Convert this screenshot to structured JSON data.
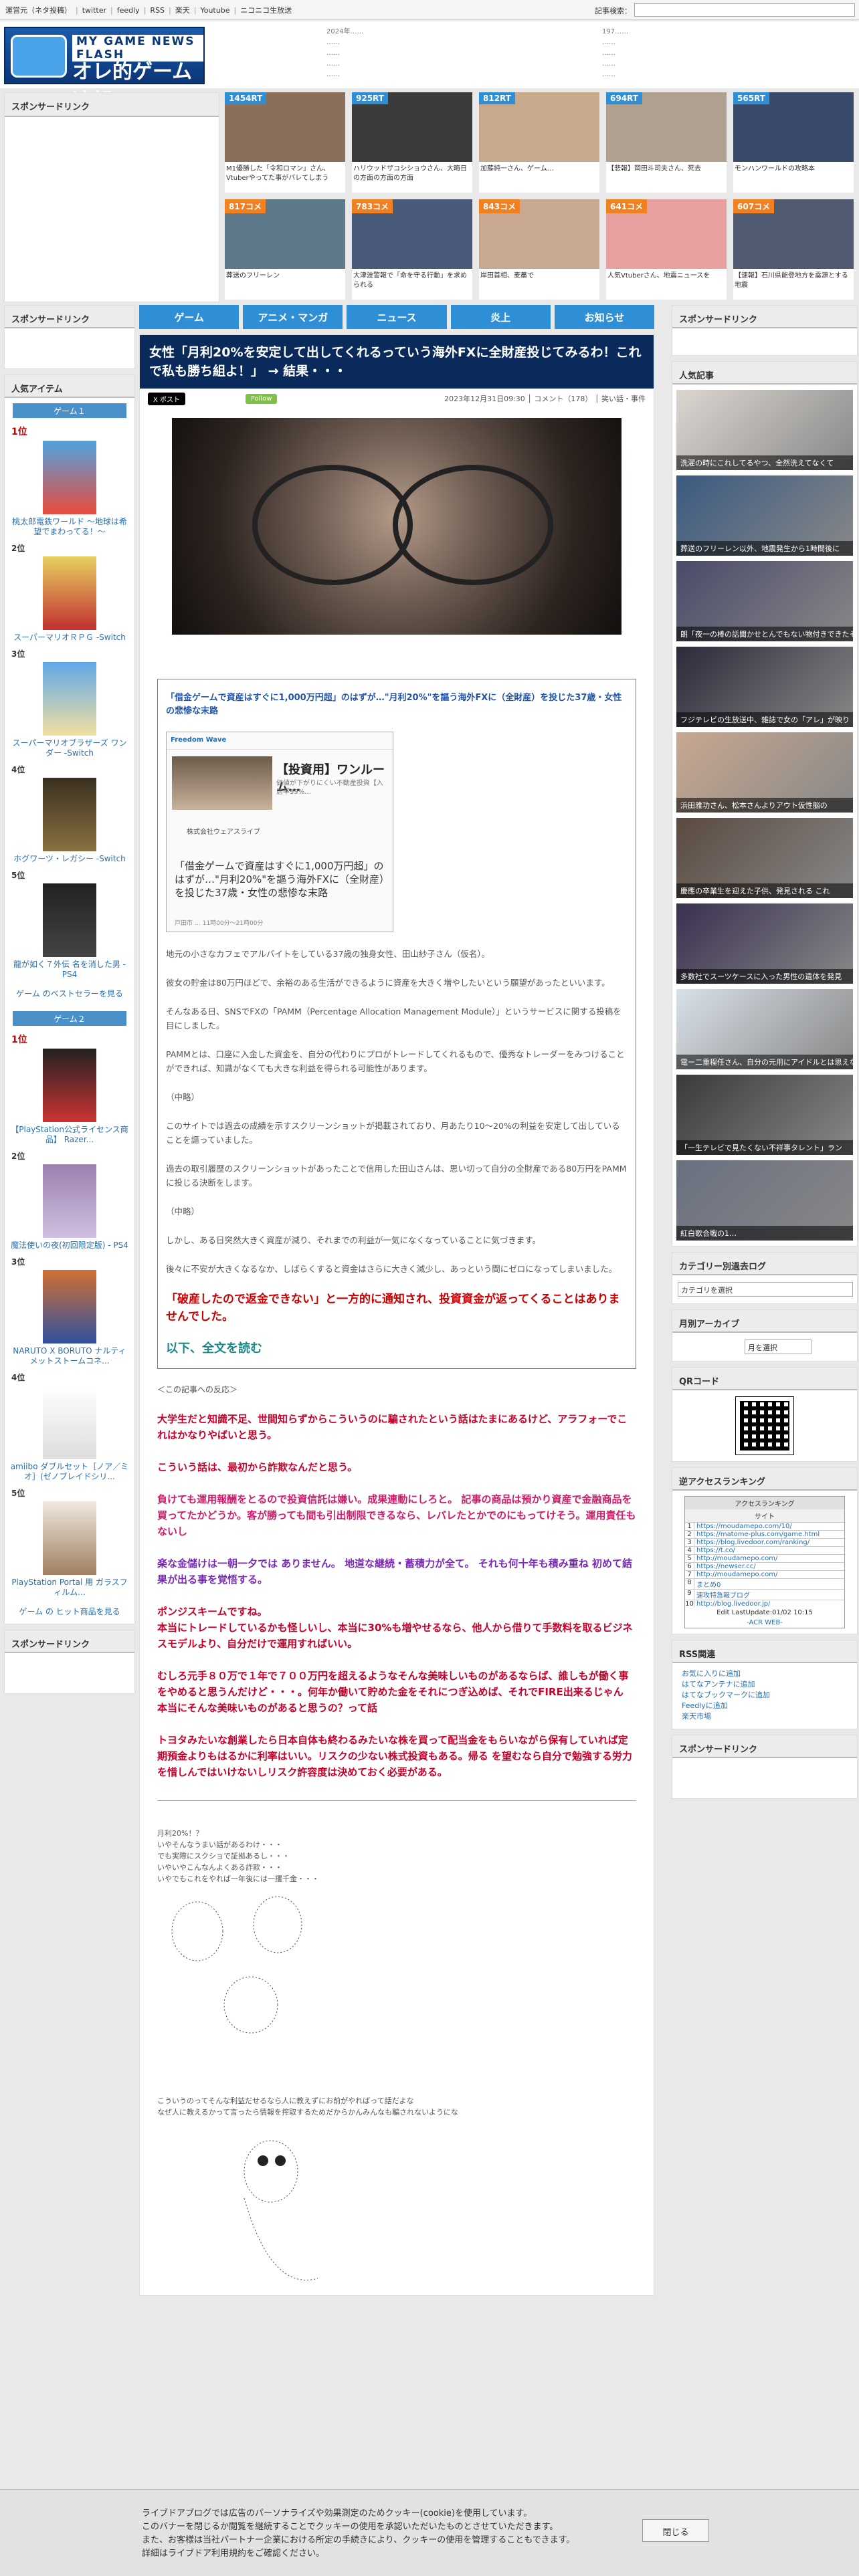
{
  "topbar": {
    "links": [
      "運営元（ネタ投稿）",
      "twitter",
      "feedly",
      "RSS",
      "楽天",
      "Youtube",
      "ニコニコ生放送"
    ],
    "search_label": "記事検索："
  },
  "header": {
    "logo_small": "MY GAME NEWS FLASH",
    "logo_big": "オレ的ゲーム速報@JIN",
    "news_left": [
      "2024年……",
      "……",
      "……",
      "……",
      "……"
    ],
    "news_right": [
      "197……",
      "……",
      "……",
      "……",
      "……"
    ]
  },
  "sponsor_left_title": "スポンサードリンク",
  "rt_cards": [
    {
      "badge": "1454RT",
      "text": "M1優勝した「令和ロマン」さん、Vtuberやってた事がバレてしまう",
      "type": "rt"
    },
    {
      "badge": "925RT",
      "text": "ハリウッドザコシショウさん、大晦日の方面の方面の方面",
      "type": "rt"
    },
    {
      "badge": "812RT",
      "text": "加藤純一さん、ゲーム…",
      "type": "rt"
    },
    {
      "badge": "694RT",
      "text": "【悲報】岡田斗司夫さん、死去",
      "type": "rt"
    },
    {
      "badge": "565RT",
      "text": "モンハンワールドの攻略本",
      "type": "rt"
    },
    {
      "badge": "817コメ",
      "text": "葬送のフリーレン",
      "type": "com"
    },
    {
      "badge": "783コメ",
      "text": "大津波警報で「命を守る行動」を求められる",
      "type": "com"
    },
    {
      "badge": "843コメ",
      "text": "岸田首相、麦藁で",
      "type": "com"
    },
    {
      "badge": "641コメ",
      "text": "人気Vtuberさん、地震ニュースを",
      "type": "com"
    },
    {
      "badge": "607コメ",
      "text": "【速報】石川県能登地方を震源とする地震",
      "type": "com"
    }
  ],
  "left_col": {
    "title": "スポンサードリンク",
    "popular_title": "人気アイテム",
    "group1": "ゲーム１",
    "items1": [
      {
        "rank": "1位",
        "name": "桃太郎電鉄ワールド ～地球は希望でまわってる！～"
      },
      {
        "rank": "2位",
        "name": "スーパーマリオＲＰＧ -Switch"
      },
      {
        "rank": "3位",
        "name": "スーパーマリオブラザーズ ワンダー -Switch"
      },
      {
        "rank": "4位",
        "name": "ホグワーツ・レガシー -Switch"
      },
      {
        "rank": "5位",
        "name": "龍が如く７外伝 名を消した男 - PS4"
      }
    ],
    "more1": "ゲーム のベストセラーを見る",
    "group2": "ゲーム２",
    "items2": [
      {
        "rank": "1位",
        "name": "【PlayStation公式ライセンス商品】 Razer..."
      },
      {
        "rank": "2位",
        "name": "魔法使いの夜(初回限定版) - PS4"
      },
      {
        "rank": "3位",
        "name": "NARUTO X BORUTO ナルティメットストームコネ..."
      },
      {
        "rank": "4位",
        "name": "amiibo ダブルセット［ノア／ミオ］(ゼノブレイドシリ..."
      },
      {
        "rank": "5位",
        "name": "PlayStation Portal 用 ガラスフィルム..."
      }
    ],
    "more2": "ゲーム の ヒット商品を見る",
    "sponsor2": "スポンサードリンク"
  },
  "nav": [
    "ゲーム",
    "アニメ・マンガ",
    "ニュース",
    "炎上",
    "お知らせ"
  ],
  "article": {
    "title": "女性「月利20%を安定して出してくれるっていう海外FXに全財産投じてみるわ！これで私も勝ち組よ！」 → 結果・・・",
    "x_button": "X ポスト",
    "follow_button": "Follow",
    "meta": "2023年12月31日09:30 │ コメント（178） │ 笑い話・事件",
    "quote_title": "「借金ゲームで資産はすぐに1,000万円超」のはずが…\"月利20%\"を謳う海外FXに（全財産）を投じた37歳・女性の悲惨な末路",
    "embed": {
      "header": "Freedom Wave",
      "headline": "【投資用】ワンルーム…",
      "sub": "価値が下がりにくい不動産投資【入居率99%…",
      "company": "株式会社ウェアスライブ",
      "big": "「借金ゲームで資産はすぐに1,000万円超」のはずが…\"月利20%\"を謳う海外FXに（全財産）を投じた37歳・女性の悲惨な末路",
      "foot": "戸田市 … 11時00分～21時00分"
    },
    "paras": [
      "地元の小さなカフェでアルバイトをしている37歳の独身女性、田山紗子さん（仮名）。",
      "彼女の貯金は80万円ほどで、余裕のある生活ができるように資産を大きく増やしたいという願望があったといいます。",
      "そんなある日、SNSでFXの「PAMM（Percentage Allocation Management Module）」というサービスに関する投稿を目にしました。",
      "PAMMとは、口座に入金した資金を、自分の代わりにプロがトレードしてくれるもので、優秀なトレーダーをみつけることができれば、知識がなくても大きな利益を得られる可能性があります。",
      "（中略）",
      "このサイトでは過去の成績を示すスクリーンショットが掲載されており、月あたり10～20%の利益を安定して出していることを謳っていました。",
      "過去の取引履歴のスクリーンショットがあったことで信用した田山さんは、思い切って自分の全財産である80万円をPAMMに投じる決断をします。",
      "（中略）",
      "しかし、ある日突然大きく資産が減り、それまでの利益が一気になくなっていることに気づきます。",
      "後々に不安が大きくなるなか、しばらくすると資金はさらに大きく減少し、あっという間にゼロになってしまいました。"
    ],
    "alert": "「破産したので返金できない」と一方的に通知され、投資資金が返ってくることはありませんでした。",
    "readmore": "以下、全文を読む",
    "reactions_head": "＜この記事への反応＞",
    "reactions": [
      {
        "c": "red",
        "t": "大学生だと知識不足、世間知らずからこういうのに騙されたという話はたまにあるけど、アラフォーでこれはかなりやばいと思う。"
      },
      {
        "c": "red",
        "t": "こういう話は、最初から詐欺なんだと思う。"
      },
      {
        "c": "pink",
        "t": "負けても運用報酬をとるので投資信託は嫌い。成果連動にしろと。 記事の商品は預かり資産で金融商品を買ってたかどうか。客が勝っても間も引出制限できるなら、レバレたとかでのにもってけそう。運用責任もないし"
      },
      {
        "c": "purple",
        "t": "楽な金儲けは一朝一夕では ありません。 地道な継続・蓄積力が全て。 それも何十年も積み重ね 初めて結果が出る事を覚悟する。"
      },
      {
        "c": "red",
        "t": "ポンジスキームですね。\n本当にトレードしているかも怪しいし、本当に30%も増やせるなら、他人から借りて手数料を取るビジネスモデルより、自分だけで運用すればいい。"
      },
      {
        "c": "red",
        "t": "むしろ元手８０万で１年で７００万円を超えるようなそんな美味しいものがあるならば、誰しもが働く事をやめると思うんだけど・・・。何年か働いて貯めた金をそれにつぎ込めば、それでFIRE出来るじゃん\n本当にそんな美味いものがあると思うの？って話"
      },
      {
        "c": "red",
        "t": "トヨタみたいな創業したら日本自体も終わるみたいな株を買って配当金をもらいながら保有していれば定期預金よりもはるかに利率はいい。リスクの少ない株式投資もある。帰る を望むなら自分で勉強する労力を惜しんではいけないしリスク許容度は決めておく必要がある。"
      }
    ],
    "aa_lines": [
      "月利20%！？",
      "いやそんなうまい話があるわけ・・・",
      "でも実際にスクショで証拠あるし・・・",
      "いやいやこんなんよくある詐欺・・・",
      "いやでもこれをやれば一年後には一攫千金・・・"
    ],
    "aa_lines2": [
      "こういうのってそんな利益だせるなら人に教えずにお前がやればって話だよな",
      "なぜ人に教えるかって言ったら情報を搾取するためだからかんみんなも騙されないようにな"
    ]
  },
  "right_col": {
    "sponsor": "スポンサードリンク",
    "popular": "人気記事",
    "pop_items": [
      "洗濯の時にこれしてるやつ、全然洗えてなくて",
      "葬送のフリーレン以外、地震発生から1時間後に",
      "朗「夜一の棒の話聞かせとんでもない物付きできたそ",
      "フジテレビの生放送中、雑誌で女の「アレ」が映り",
      "浜田雅功さん、松本さんよりアウト仮性脳の",
      "慶應の卒業生を迎えた子供、発見される これ",
      "多数社でスーツケースに入った男性の遺体を発見",
      "電ー二重程任さん、自分の元用にアイドルとは思えなし",
      "「一生テレビで見たくない不祥事タレント」ラン",
      "紅白歌合戦の1…"
    ],
    "category_title": "カテゴリー別過去ログ",
    "category_select": "カテゴリを選択",
    "archive_title": "月別アーカイブ",
    "archive_select": "月を選択",
    "qr_title": "QRコード",
    "access_title": "逆アクセスランキング",
    "access_header": "アクセスランキング",
    "access_sub": "サイト",
    "access_rows": [
      "https://moudamepo.com/10/",
      "https://matome-plus.com/game.html",
      "https://blog.livedoor.com/ranking/",
      "https://t.co/",
      "http://moudamepo.com/",
      "https://newser.cc/",
      "http://moudamepo.com/",
      "まとめ0",
      "速攻特急報ブログ",
      "http://blog.livedoor.jp/"
    ],
    "access_footer": "Edit LastUpdate:01/02 10:15",
    "access_brand": "-ACR WEB-",
    "rss_title": "RSS関連",
    "rss_links": [
      "お気に入りに追加",
      "はてなアンテナに追加",
      "はてなブックマークに追加",
      "Feedlyに追加",
      "楽天市場"
    ],
    "sponsor_bottom": "スポンサードリンク"
  },
  "cookie": {
    "text": [
      "ライブドアブログでは広告のパーソナライズや効果測定のためクッキー(cookie)を使用しています。",
      "このバナーを閉じるか閲覧を継続することでクッキーの使用を承認いただいたものとさせていただきます。",
      "また、お客様は当社パートナー企業における所定の手続きにより、クッキーの使用を管理することもできます。",
      "詳細はライブドア利用規約をご確認ください。"
    ],
    "close": "閉じる"
  }
}
